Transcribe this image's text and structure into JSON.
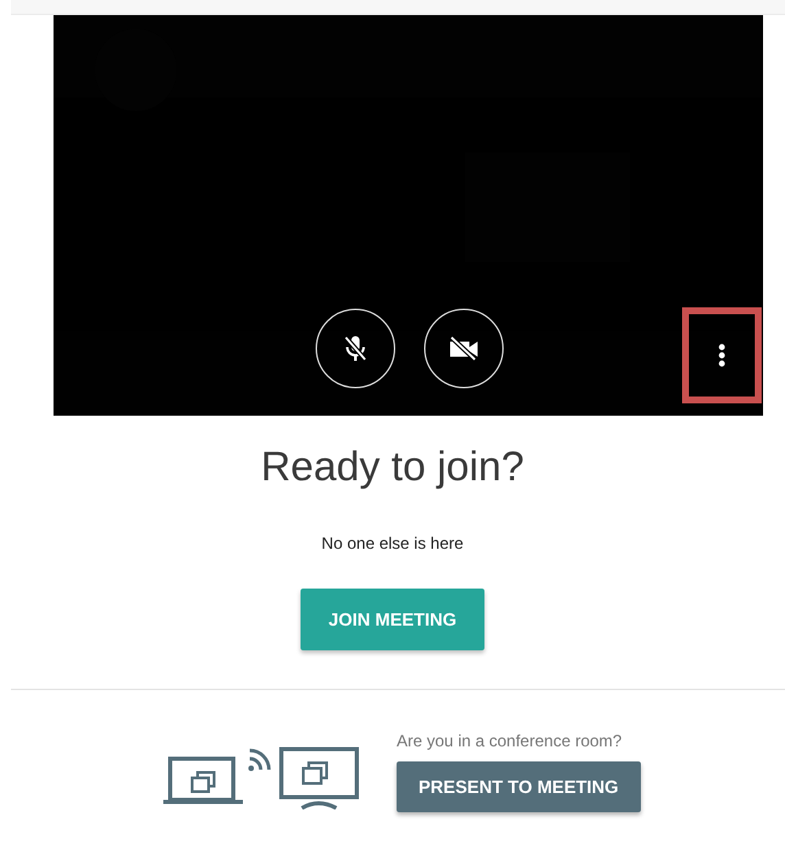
{
  "preview": {
    "mic_button": {
      "muted": true
    },
    "camera_button": {
      "off": true
    },
    "more_button": {
      "highlighted": true
    }
  },
  "title": "Ready to join?",
  "status": "No one else is here",
  "join_button": "JOIN MEETING",
  "present": {
    "question": "Are you in a conference room?",
    "button": "PRESENT TO MEETING"
  }
}
